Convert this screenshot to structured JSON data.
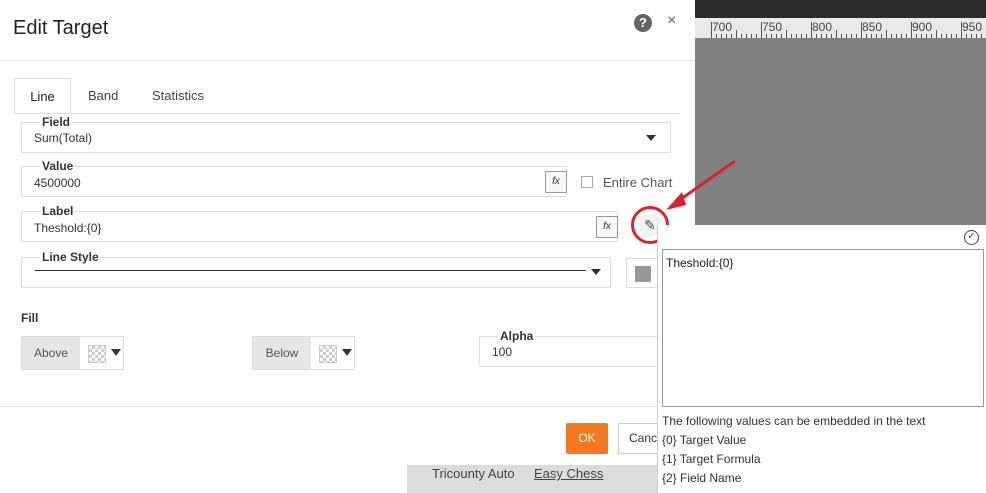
{
  "dialog": {
    "title": "Edit Target",
    "help_icon": "?",
    "close_icon": "×"
  },
  "tabs": [
    {
      "label": "Line",
      "active": true
    },
    {
      "label": "Band",
      "active": false
    },
    {
      "label": "Statistics",
      "active": false
    }
  ],
  "field": {
    "legend": "Field",
    "value": "Sum(Total)"
  },
  "value": {
    "legend": "Value",
    "value": "4500000",
    "fx_icon": "fx"
  },
  "entire_chart": {
    "label": "Entire Chart",
    "checked": false
  },
  "label": {
    "legend": "Label",
    "value": "Theshold:{0}",
    "fx_icon": "fx",
    "pencil_icon": "✎"
  },
  "line_style": {
    "legend": "Line Style"
  },
  "fill": {
    "label": "Fill",
    "above_label": "Above",
    "below_label": "Below",
    "alpha_legend": "Alpha",
    "alpha_value": "100"
  },
  "footer": {
    "ok_label": "OK",
    "cancel_label": "Cancel"
  },
  "popup": {
    "check_icon": "✓",
    "text": "Theshold:{0}",
    "info_lines": [
      "The following values can be embedded in the text",
      "{0} Target Value",
      "{1} Target Formula",
      "{2} Field Name"
    ]
  },
  "background": {
    "ruler_labels": [
      "700",
      "750",
      "800",
      "850",
      "900",
      "950"
    ],
    "table_cell_1": "Tricounty Auto",
    "table_cell_2": "Easy Chess"
  },
  "colors": {
    "accent": "#f47920",
    "highlight": "#d9232a"
  }
}
